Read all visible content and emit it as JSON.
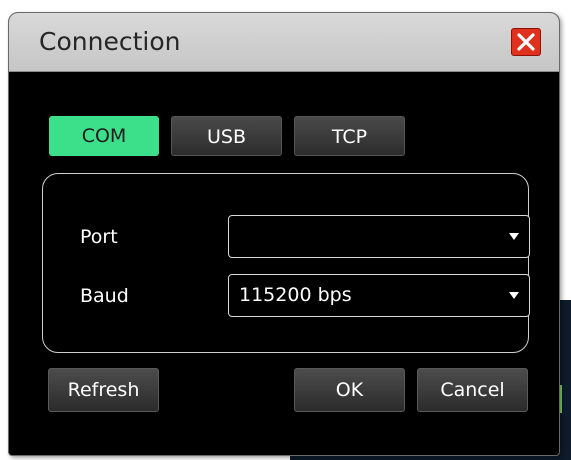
{
  "dialog": {
    "title": "Connection",
    "close_icon": "close-icon"
  },
  "tabs": [
    {
      "label": "COM",
      "active": true
    },
    {
      "label": "USB",
      "active": false
    },
    {
      "label": "TCP",
      "active": false
    }
  ],
  "fields": {
    "port": {
      "label": "Port",
      "value": ""
    },
    "baud": {
      "label": "Baud",
      "value": "115200 bps"
    }
  },
  "buttons": {
    "refresh": "Refresh",
    "ok": "OK",
    "cancel": "Cancel"
  },
  "colors": {
    "active_tab": "#3de08a",
    "close": "#e0301e",
    "background": "#000000"
  }
}
